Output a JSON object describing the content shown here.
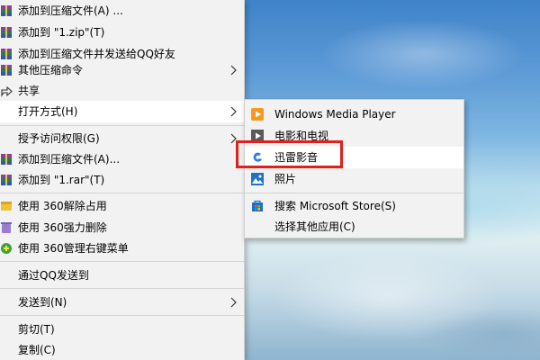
{
  "context_menu": {
    "items": [
      {
        "label": "添加到压缩文件(A) ...",
        "icon": "winrar-archive-icon",
        "submenu": false
      },
      {
        "label": "添加到 \"1.zip\"(T)",
        "icon": "winrar-archive-icon",
        "submenu": false
      },
      {
        "label": "添加到压缩文件并发送给QQ好友",
        "icon": "winrar-archive-icon",
        "submenu": false
      },
      {
        "label": "其他压缩命令",
        "icon": "winrar-archive-icon",
        "submenu": true
      },
      {
        "label": "共享",
        "icon": "share-icon",
        "submenu": false
      },
      {
        "label": "打开方式(H)",
        "icon": "",
        "submenu": true
      },
      {
        "label": "授予访问权限(G)",
        "icon": "",
        "submenu": true
      },
      {
        "label": "添加到压缩文件(A)...",
        "icon": "winrar-archive-icon",
        "submenu": false
      },
      {
        "label": "添加到 \"1.rar\"(T)",
        "icon": "winrar-archive-icon",
        "submenu": false
      },
      {
        "label": "使用 360解除占用",
        "icon": "360-unlock-icon",
        "submenu": false
      },
      {
        "label": "使用 360强力删除",
        "icon": "360-delete-icon",
        "submenu": false
      },
      {
        "label": "使用 360管理右键菜单",
        "icon": "360-manage-icon",
        "submenu": false
      },
      {
        "label": "通过QQ发送到",
        "icon": "",
        "submenu": false
      },
      {
        "label": "发送到(N)",
        "icon": "",
        "submenu": true
      },
      {
        "label": "剪切(T)",
        "icon": "",
        "submenu": false
      },
      {
        "label": "复制(C)",
        "icon": "",
        "submenu": false
      }
    ]
  },
  "open_with_submenu": {
    "items": [
      {
        "label": "Windows Media Player",
        "icon": "windows-media-player-icon"
      },
      {
        "label": "电影和电视",
        "icon": "movies-tv-icon"
      },
      {
        "label": "迅雷影音",
        "icon": "xunlei-player-icon"
      },
      {
        "label": "照片",
        "icon": "photos-icon"
      },
      {
        "label": "搜索 Microsoft Store(S)",
        "icon": "microsoft-store-icon"
      },
      {
        "label": "选择其他应用(C)",
        "icon": ""
      }
    ]
  },
  "colors": {
    "menu_background": "#f2f2f2",
    "highlight_border": "#e0201b"
  }
}
